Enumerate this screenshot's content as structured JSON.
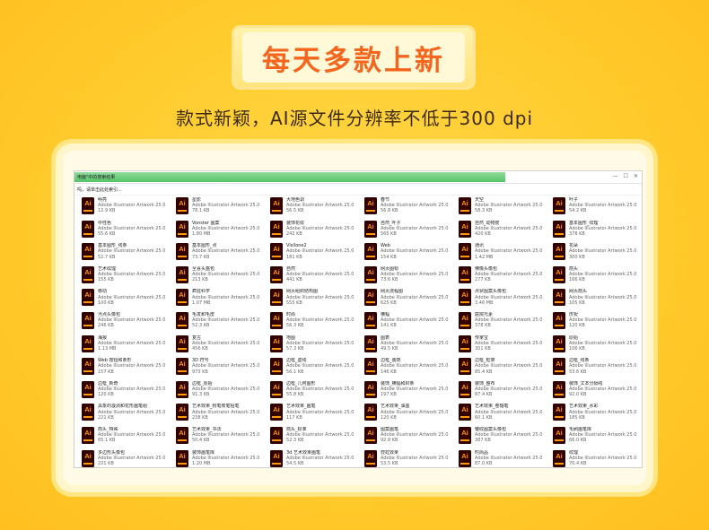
{
  "banner": {
    "title": "每天多款上新"
  },
  "subtitle": "款式新颖，AI源文件分辨率不低于300 dpi",
  "window": {
    "title": "电脑\"中的搜索结果",
    "search_hint": "吗，请单击此处索引...",
    "controls": [
      "—",
      "☐",
      "✕"
    ],
    "progress": 0.76
  },
  "icon": {
    "name": "ai-file-icon",
    "label": "Ai",
    "bg": "#330000",
    "fg": "#ff9a00"
  },
  "files": [
    {
      "name": "明亮",
      "type": "Adobe Illustrator Artwork 25.0",
      "size": "12.9 KB"
    },
    {
      "name": "星影",
      "type": "Adobe Illustrator Artwork 25.0",
      "size": "78.1 KB"
    },
    {
      "name": "大地色调",
      "type": "Adobe Illustrator Artwork 25.0",
      "size": "56.5 KB"
    },
    {
      "name": "春节",
      "type": "Adobe Illustrator Artwork 25.0",
      "size": "56.8 KB"
    },
    {
      "name": "天空",
      "type": "Adobe Illustrator Artwork 25.0",
      "size": "58.3 KB"
    },
    {
      "name": "叶子",
      "type": "Adobe Illustrator Artwork 25.0",
      "size": "54.2 KB"
    },
    {
      "name": "中性色",
      "type": "Adobe Illustrator Artwork 25.0",
      "size": "55.6 KB"
    },
    {
      "name": "Vonster 图案",
      "type": "Adobe Illustrator Artwork 25.0",
      "size": "1.80 MB"
    },
    {
      "name": "装饰花纹",
      "type": "Adobe Illustrator Artwork 25.0",
      "size": "242 KB"
    },
    {
      "name": "自然_叶子",
      "type": "Adobe Illustrator Artwork 25.0",
      "size": "565 KB"
    },
    {
      "name": "自然_动物皮",
      "type": "Adobe Illustrator Artwork 25.0",
      "size": "420 KB"
    },
    {
      "name": "基本图形_纹理",
      "type": "Adobe Illustrator Artwork 25.0",
      "size": "378 KB"
    },
    {
      "name": "基本图形_线条",
      "type": "Adobe Illustrator Artwork 25.0",
      "size": "52.7 KB"
    },
    {
      "name": "基本图形_点",
      "type": "Adobe Illustrator Artwork 25.0",
      "size": "73.7 KB"
    },
    {
      "name": "Vlsllone2",
      "type": "Adobe Illustrator Artwork 25.0",
      "size": "181 KB"
    },
    {
      "name": "Web",
      "type": "Adobe Illustrator Artwork 25.0",
      "size": "154 KB"
    },
    {
      "name": "通讯",
      "type": "Adobe Illustrator Artwork 25.0",
      "size": "1.42 MB"
    },
    {
      "name": "花朵",
      "type": "Adobe Illustrator Artwork 25.0",
      "size": "300 KB"
    },
    {
      "name": "艺术纹理",
      "type": "Adobe Illustrator Artwork 25.0",
      "size": "155 KB"
    },
    {
      "name": "至喜头盔包",
      "type": "Adobe Illustrator Artwork 25.0",
      "size": "213 KB"
    },
    {
      "name": "自然",
      "type": "Adobe Illustrator Artwork 25.0",
      "size": "441 KB"
    },
    {
      "name": "网页图标",
      "type": "Adobe Illustrator Artwork 25.0",
      "size": "73.6 KB"
    },
    {
      "name": "佛像头像包",
      "type": "Adobe Illustrator Artwork 25.0",
      "size": "277 KB"
    },
    {
      "name": "箭头",
      "type": "Adobe Illustrator Artwork 25.0",
      "size": "166 KB"
    },
    {
      "name": "移动",
      "type": "Adobe Illustrator Artwork 25.0",
      "size": "100 KB"
    },
    {
      "name": "疯狂科学",
      "type": "Adobe Illustrator Artwork 25.0",
      "size": "1.07 MB"
    },
    {
      "name": "网页组织结构图",
      "type": "Adobe Illustrator Artwork 25.0",
      "size": "555 KB"
    },
    {
      "name": "网页流程图",
      "type": "Adobe Illustrator Artwork 25.0",
      "size": "625 KB"
    },
    {
      "name": "点状图案头像包",
      "type": "Adobe Illustrator Artwork 25.0",
      "size": "3.46 MB"
    },
    {
      "name": "网页箭头",
      "type": "Adobe Illustrator Artwork 25.0",
      "size": "105 KB"
    },
    {
      "name": "污点头像包",
      "type": "Adobe Illustrator Artwork 25.0",
      "size": "246 KB"
    },
    {
      "name": "毛发和毛皮",
      "type": "Adobe Illustrator Artwork 25.0",
      "size": "52.3 KB"
    },
    {
      "name": "时尚",
      "type": "Adobe Illustrator Artwork 25.0",
      "size": "56.3 KB"
    },
    {
      "name": "横幅",
      "type": "Adobe Illustrator Artwork 25.0",
      "size": "141 KB"
    },
    {
      "name": "庭院元素",
      "type": "Adobe Illustrator Artwork 25.0",
      "size": "378 KB"
    },
    {
      "name": "庆祝",
      "type": "Adobe Illustrator Artwork 25.0",
      "size": "120 KB"
    },
    {
      "name": "海报",
      "type": "Adobe Illustrator Artwork 25.0",
      "size": "1.13 MB"
    },
    {
      "name": "复古",
      "type": "Adobe Illustrator Artwork 25.0",
      "size": "456 KB"
    },
    {
      "name": "地图",
      "type": "Adobe Illustrator Artwork 25.0",
      "size": "57.3 KB"
    },
    {
      "name": "图表",
      "type": "Adobe Illustrator Artwork 25.0",
      "size": "49.5 KB"
    },
    {
      "name": "传家宝",
      "type": "Adobe Illustrator Artwork 25.0",
      "size": "301 KB"
    },
    {
      "name": "原始",
      "type": "Adobe Illustrator Artwork 25.0",
      "size": "106 KB"
    },
    {
      "name": "Web 按钮和条形",
      "type": "Adobe Illustrator Artwork 25.0",
      "size": "157 KB"
    },
    {
      "name": "3D 符号",
      "type": "Adobe Illustrator Artwork 25.0",
      "size": "973 KB"
    },
    {
      "name": "边框_虚线",
      "type": "Adobe Illustrator Artwork 25.0",
      "size": "56.1 KB"
    },
    {
      "name": "边框_装饰",
      "type": "Adobe Illustrator Artwork 25.0",
      "size": "146 KB"
    },
    {
      "name": "边框_框架",
      "type": "Adobe Illustrator Artwork 25.0",
      "size": "85.4 KB"
    },
    {
      "name": "边框_线条",
      "type": "Adobe Illustrator Artwork 25.0",
      "size": "53.6 KB"
    },
    {
      "name": "边框_新奇",
      "type": "Adobe Illustrator Artwork 25.0",
      "size": "120 KB"
    },
    {
      "name": "边框_原始",
      "type": "Adobe Illustrator Artwork 25.0",
      "size": "91.3 KB"
    },
    {
      "name": "边框_几何图形",
      "type": "Adobe Illustrator Artwork 25.0",
      "size": "55.8 KB"
    },
    {
      "name": "装饰_横幅和封条",
      "type": "Adobe Illustrator Artwork 25.0",
      "size": "197 KB"
    },
    {
      "name": "装饰_整布",
      "type": "Adobe Illustrator Artwork 25.0",
      "size": "87.4 KB"
    },
    {
      "name": "装饰_文本分隔线",
      "type": "Adobe Illustrator Artwork 25.0",
      "size": "92.0 KB"
    },
    {
      "name": "具象的漩涡和花形画笔组",
      "type": "Adobe Illustrator Artwork 25.0",
      "size": "221 KB"
    },
    {
      "name": "艺术效果_粉笔炭笔铅笔",
      "type": "Adobe Illustrator Artwork 25.0",
      "size": "238 KB"
    },
    {
      "name": "艺术效果_画笔",
      "type": "Adobe Illustrator Artwork 25.0",
      "size": "117 KB"
    },
    {
      "name": "艺术效果_油墨",
      "type": "Adobe Illustrator Artwork 25.0",
      "size": "120 KB"
    },
    {
      "name": "艺术效果_卷轴笔",
      "type": "Adobe Illustrator Artwork 25.0",
      "size": "60.1 KB"
    },
    {
      "name": "艺术效果_水彩",
      "type": "Adobe Illustrator Artwork 25.0",
      "size": "185 KB"
    },
    {
      "name": "箭头_特殊",
      "type": "Adobe Illustrator Artwork 25.0",
      "size": "65.1 KB"
    },
    {
      "name": "艺术效果_书法",
      "type": "Adobe Illustrator Artwork 25.0",
      "size": "50.4 KB"
    },
    {
      "name": "箭头_标准",
      "type": "Adobe Illustrator Artwork 25.0",
      "size": "52.3 KB"
    },
    {
      "name": "图案画笔",
      "type": "Adobe Illustrator Artwork 25.0",
      "size": "92.8 KB"
    },
    {
      "name": "皱纹图案头像包",
      "type": "Adobe Illustrator Artwork 25.0",
      "size": "387 KB"
    },
    {
      "name": "毛刷画笔库",
      "type": "Adobe Illustrator Artwork 25.0",
      "size": "66.0 KB"
    },
    {
      "name": "多边形头像包",
      "type": "Adobe Illustrator Artwork 25.0",
      "size": "221 KB"
    },
    {
      "name": "装饰画笔库",
      "type": "Adobe Illustrator Artwork 25.0",
      "size": "1.20 MB"
    },
    {
      "name": "3d 艺术效果画笔",
      "type": "Adobe Illustrator Artwork 25.0",
      "size": "54.5 KB"
    },
    {
      "name": "霓虹效果",
      "type": "Adobe Illustrator Artwork 25.0",
      "size": "53.5 KB"
    },
    {
      "name": "时尚品",
      "type": "Adobe Illustrator Artwork 25.0",
      "size": "87.0 KB"
    },
    {
      "name": "纹理",
      "type": "Adobe Illustrator Artwork 25.0",
      "size": "70.4 KB"
    }
  ]
}
